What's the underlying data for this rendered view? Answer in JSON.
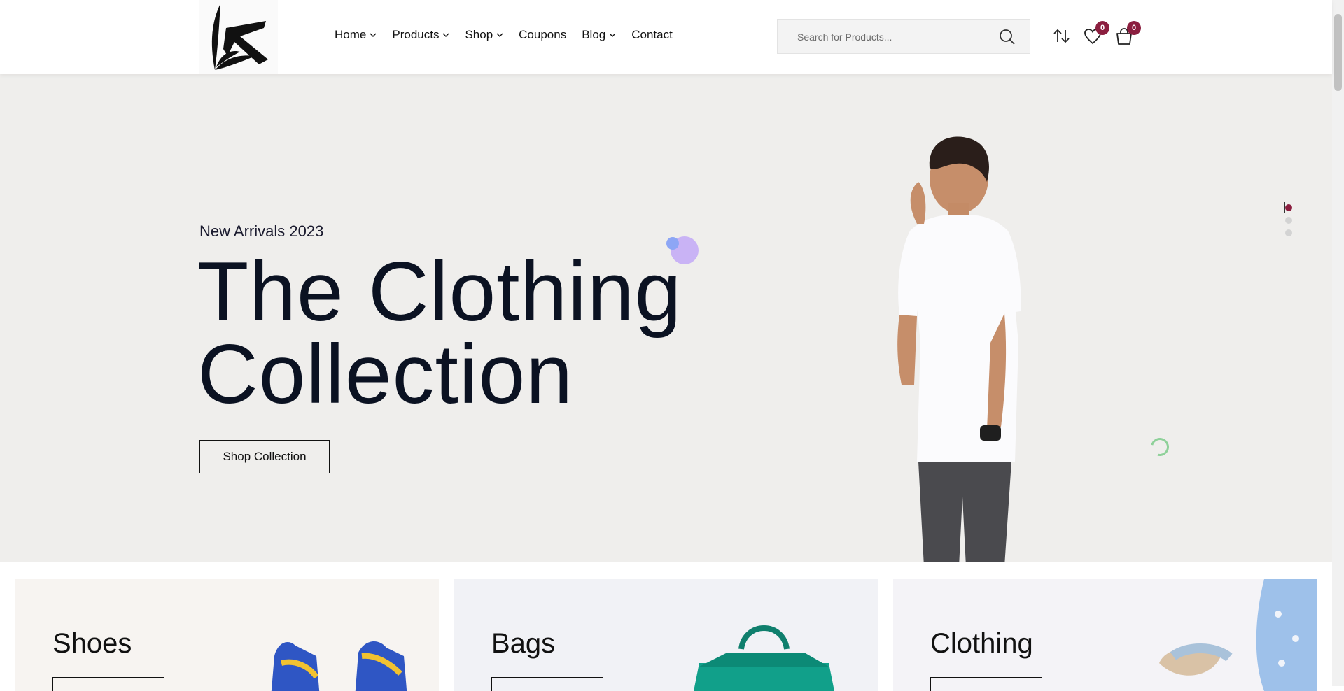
{
  "header": {
    "nav": [
      {
        "label": "Home",
        "dropdown": true
      },
      {
        "label": "Products",
        "dropdown": true
      },
      {
        "label": "Shop",
        "dropdown": true
      },
      {
        "label": "Coupons",
        "dropdown": false
      },
      {
        "label": "Blog",
        "dropdown": true
      },
      {
        "label": "Contact",
        "dropdown": false
      }
    ],
    "search": {
      "placeholder": "Search for Products..."
    },
    "wishlist_count": "0",
    "cart_count": "0"
  },
  "hero": {
    "subtitle": "New Arrivals 2023",
    "title_line1": "The Clothing",
    "title_line2": "Collection",
    "button_label": "Shop Collection",
    "slides_total": 3,
    "active_slide": 1
  },
  "categories": [
    {
      "name": "Shoes",
      "bg": "#f7f4f1"
    },
    {
      "name": "Bags",
      "bg": "#f1f2f6"
    },
    {
      "name": "Clothing",
      "bg": "#f4f3f7"
    }
  ],
  "colors": {
    "accent": "#8b1e3f",
    "hero_bg": "#efeeec",
    "text": "#0b1222"
  }
}
